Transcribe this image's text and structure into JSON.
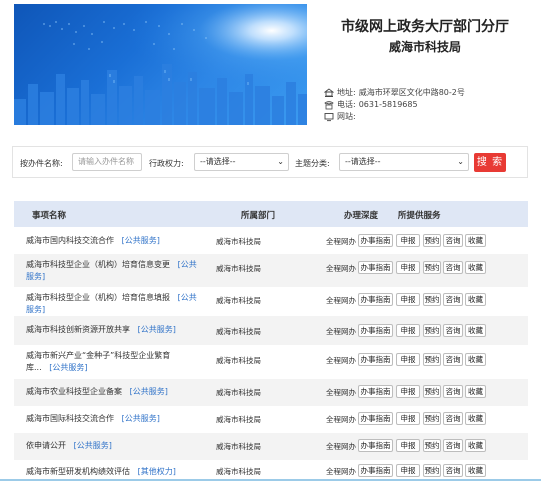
{
  "header": {
    "title": "市级网上政务大厅部门分厅",
    "department": "威海市科技局",
    "address_label": "地址:",
    "address": "威海市环翠区文化中路80-2号",
    "phone_label": "电话:",
    "phone": "0631-5819685",
    "website_label": "网站:",
    "website": ""
  },
  "search": {
    "name_label": "按办件名称:",
    "name_placeholder": "请输入办件名称",
    "power_label": "行政权力:",
    "power_value": "--请选择--",
    "topic_label": "主题分类:",
    "topic_value": "--请选择--",
    "button": "搜 索"
  },
  "table": {
    "headers": [
      "事项名称",
      "所属部门",
      "办理深度",
      "所提供服务"
    ],
    "services": [
      "办事指南",
      "申报",
      "预约",
      "咨询",
      "收藏"
    ],
    "rows": [
      {
        "name": "威海市国内科技交流合作",
        "tag": "[公共服务]",
        "dept": "威海市科技局",
        "depth": "全程网办"
      },
      {
        "name": "威海市科技型企业（机构）培育信息变更",
        "tag": "[公共服务]",
        "dept": "威海市科技局",
        "depth": "全程网办"
      },
      {
        "name": "威海市科技型企业（机构）培育信息填报",
        "tag": "[公共服务]",
        "dept": "威海市科技局",
        "depth": "全程网办"
      },
      {
        "name": "威海市科技创新资源开放共享",
        "tag": "[公共服务]",
        "dept": "威海市科技局",
        "depth": "全程网办"
      },
      {
        "name": "威海市新兴产业“金种子”科技型企业繁育库...",
        "tag": "[公共服务]",
        "dept": "威海市科技局",
        "depth": "全程网办"
      },
      {
        "name": "威海市农业科技型企业备案",
        "tag": "[公共服务]",
        "dept": "威海市科技局",
        "depth": "全程网办"
      },
      {
        "name": "威海市国际科技交流合作",
        "tag": "[公共服务]",
        "dept": "威海市科技局",
        "depth": "全程网办"
      },
      {
        "name": "依申请公开",
        "tag": "[公共服务]",
        "dept": "威海市科技局",
        "depth": "全程网办"
      },
      {
        "name": "威海市新型研发机构绩效评估",
        "tag": "[其他权力]",
        "dept": "威海市科技局",
        "depth": "全程网办"
      }
    ]
  },
  "colors": {
    "accent_red": "#e83a34",
    "tag_blue": "#2f72c8",
    "header_bg": "#dfe7f5"
  }
}
